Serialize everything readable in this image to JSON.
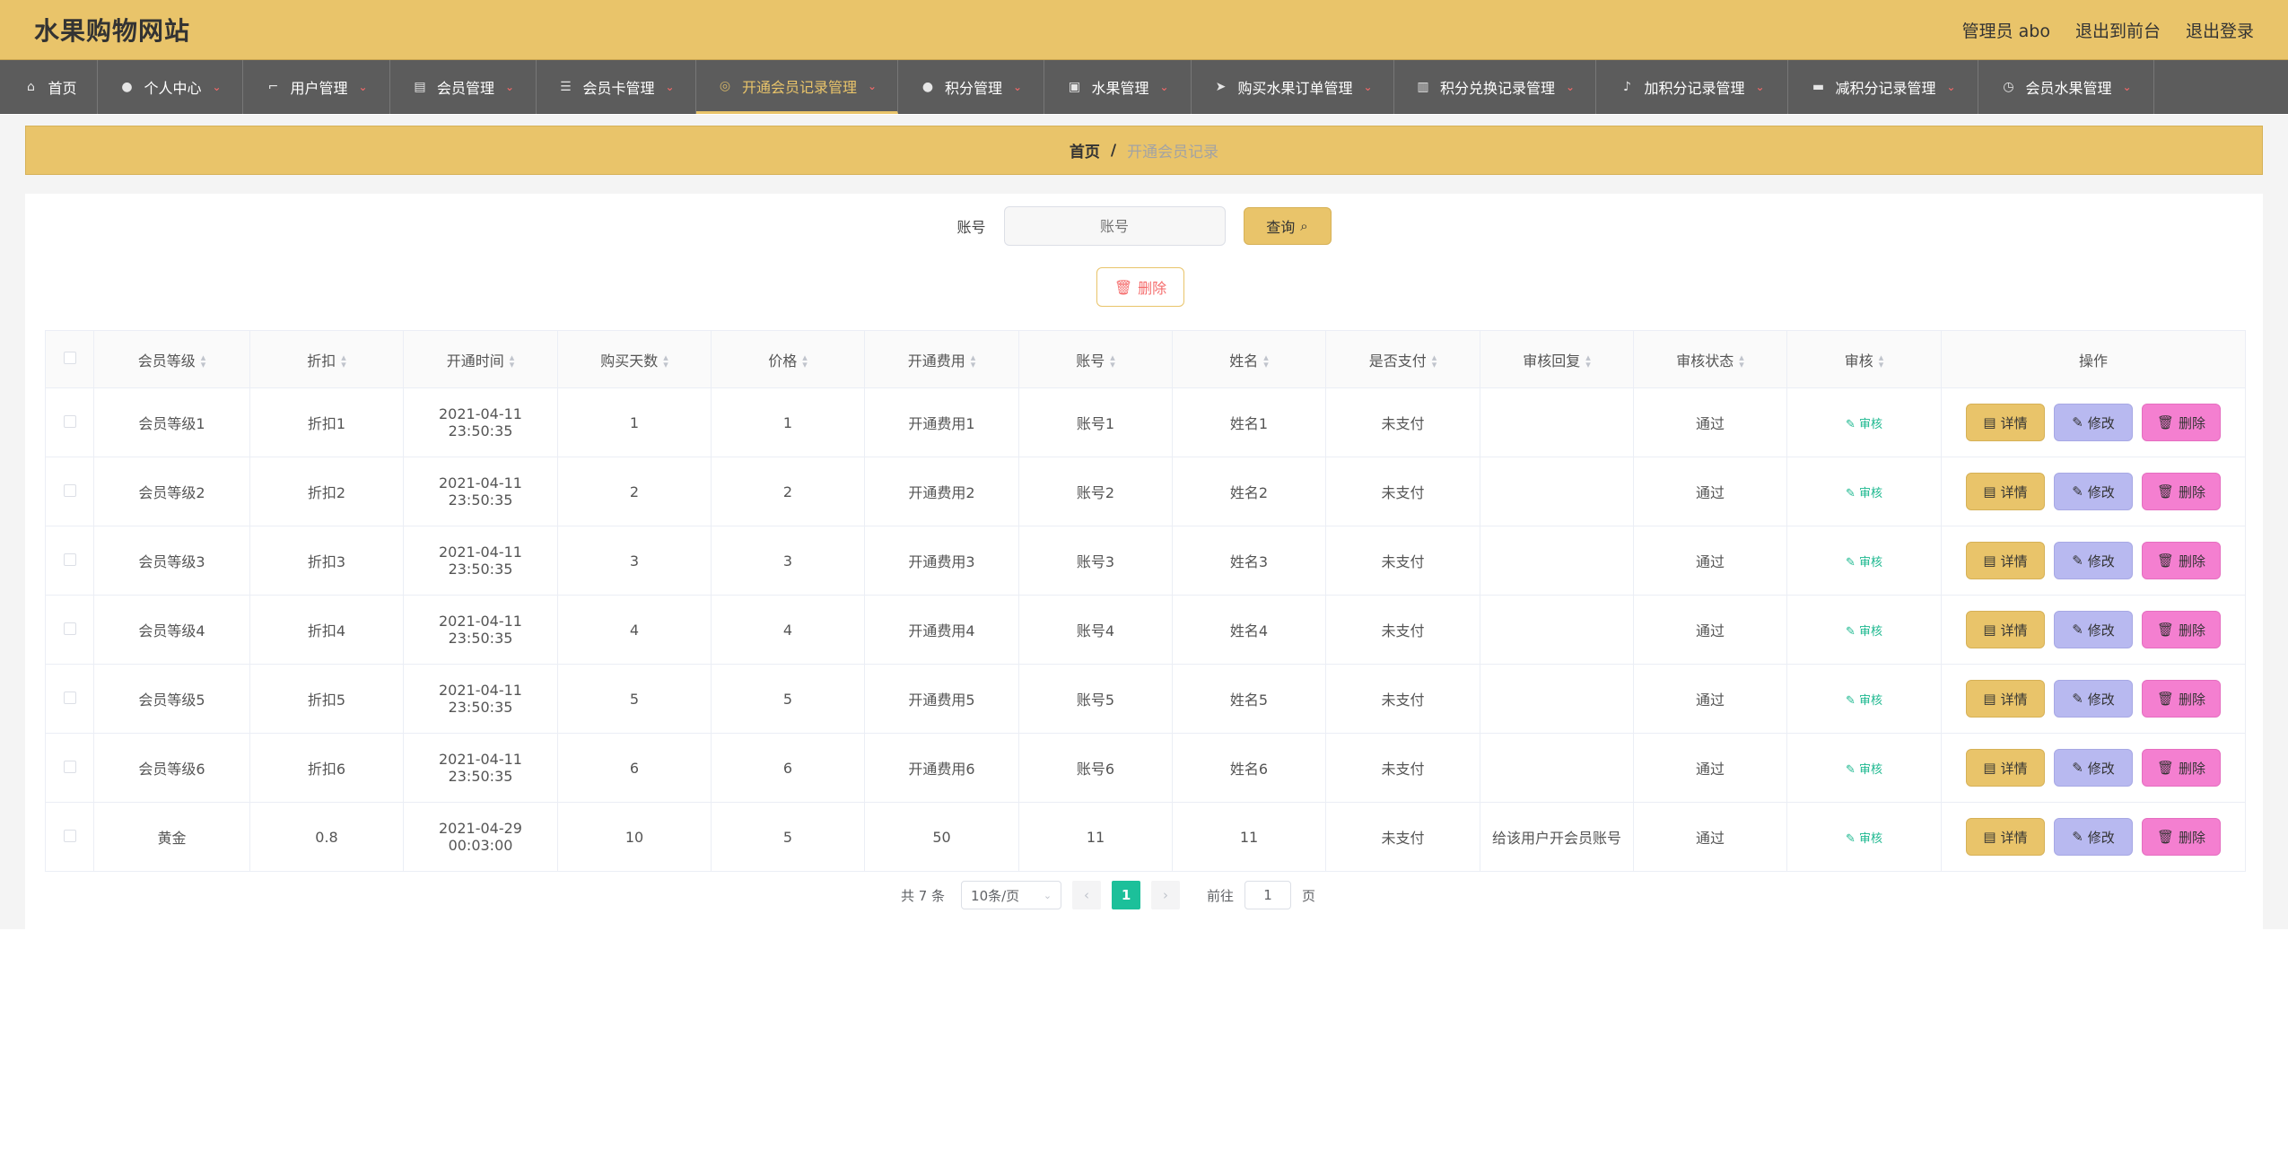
{
  "app": {
    "title": "水果购物网站",
    "admin_label": "管理员 abo",
    "front_link": "退出到前台",
    "logout_link": "退出登录"
  },
  "nav": [
    {
      "label": "首页",
      "icon": "home-icon",
      "glyph": "⌂"
    },
    {
      "label": "个人中心",
      "icon": "user-icon",
      "glyph": "●"
    },
    {
      "label": "用户管理",
      "icon": "crop-icon",
      "glyph": "⌐"
    },
    {
      "label": "会员管理",
      "icon": "calendar-icon",
      "glyph": "▤"
    },
    {
      "label": "会员卡管理",
      "icon": "list-icon",
      "glyph": "☰"
    },
    {
      "label": "开通会员记录管理",
      "icon": "compass-icon",
      "glyph": "◎"
    },
    {
      "label": "积分管理",
      "icon": "user-icon",
      "glyph": "●"
    },
    {
      "label": "水果管理",
      "icon": "suitcase-icon",
      "glyph": "▣"
    },
    {
      "label": "购买水果订单管理",
      "icon": "send-icon",
      "glyph": "➤"
    },
    {
      "label": "积分兑换记录管理",
      "icon": "chart-icon",
      "glyph": "▥"
    },
    {
      "label": "加积分记录管理",
      "icon": "microphone-icon",
      "glyph": "♪"
    },
    {
      "label": "减积分记录管理",
      "icon": "printer-icon",
      "glyph": "▬"
    },
    {
      "label": "会员水果管理",
      "icon": "clock-icon",
      "glyph": "◷"
    }
  ],
  "breadcrumb": {
    "home": "首页",
    "separator": "/",
    "current": "开通会员记录"
  },
  "search": {
    "label": "账号",
    "placeholder": "账号",
    "button": "查询"
  },
  "toolbar": {
    "delete_label": "删除"
  },
  "table": {
    "headers": [
      "会员等级",
      "折扣",
      "开通时间",
      "购买天数",
      "价格",
      "开通费用",
      "账号",
      "姓名",
      "是否支付",
      "审核回复",
      "审核状态",
      "审核",
      "操作"
    ],
    "rows": [
      {
        "level": "会员等级1",
        "discount": "折扣1",
        "time": "2021-04-11 23:50:35",
        "days": "1",
        "price": "1",
        "fee": "开通费用1",
        "account": "账号1",
        "name": "姓名1",
        "paid": "未支付",
        "reply": "",
        "status": "通过",
        "audit": "审核"
      },
      {
        "level": "会员等级2",
        "discount": "折扣2",
        "time": "2021-04-11 23:50:35",
        "days": "2",
        "price": "2",
        "fee": "开通费用2",
        "account": "账号2",
        "name": "姓名2",
        "paid": "未支付",
        "reply": "",
        "status": "通过",
        "audit": "审核"
      },
      {
        "level": "会员等级3",
        "discount": "折扣3",
        "time": "2021-04-11 23:50:35",
        "days": "3",
        "price": "3",
        "fee": "开通费用3",
        "account": "账号3",
        "name": "姓名3",
        "paid": "未支付",
        "reply": "",
        "status": "通过",
        "audit": "审核"
      },
      {
        "level": "会员等级4",
        "discount": "折扣4",
        "time": "2021-04-11 23:50:35",
        "days": "4",
        "price": "4",
        "fee": "开通费用4",
        "account": "账号4",
        "name": "姓名4",
        "paid": "未支付",
        "reply": "",
        "status": "通过",
        "audit": "审核"
      },
      {
        "level": "会员等级5",
        "discount": "折扣5",
        "time": "2021-04-11 23:50:35",
        "days": "5",
        "price": "5",
        "fee": "开通费用5",
        "account": "账号5",
        "name": "姓名5",
        "paid": "未支付",
        "reply": "",
        "status": "通过",
        "audit": "审核"
      },
      {
        "level": "会员等级6",
        "discount": "折扣6",
        "time": "2021-04-11 23:50:35",
        "days": "6",
        "price": "6",
        "fee": "开通费用6",
        "account": "账号6",
        "name": "姓名6",
        "paid": "未支付",
        "reply": "",
        "status": "通过",
        "audit": "审核"
      },
      {
        "level": "黄金",
        "discount": "0.8",
        "time": "2021-04-29 00:03:00",
        "days": "10",
        "price": "5",
        "fee": "50",
        "account": "11",
        "name": "11",
        "paid": "未支付",
        "reply": "给该用户开会员账号",
        "status": "通过",
        "audit": "审核"
      }
    ],
    "row_actions": {
      "detail": "详情",
      "edit": "修改",
      "delete": "删除"
    }
  },
  "pagination": {
    "total": "共 7 条",
    "page_size": "10条/页",
    "current_page": "1",
    "goto_label": "前往",
    "goto_value": "1",
    "page_suffix": "页"
  },
  "colors": {
    "accent": "#e9c46a",
    "nav_bg": "#5c5c5c",
    "active_page": "#1cc09a",
    "edit_btn": "#b8b9f0",
    "delete_btn": "#f47fd0"
  }
}
